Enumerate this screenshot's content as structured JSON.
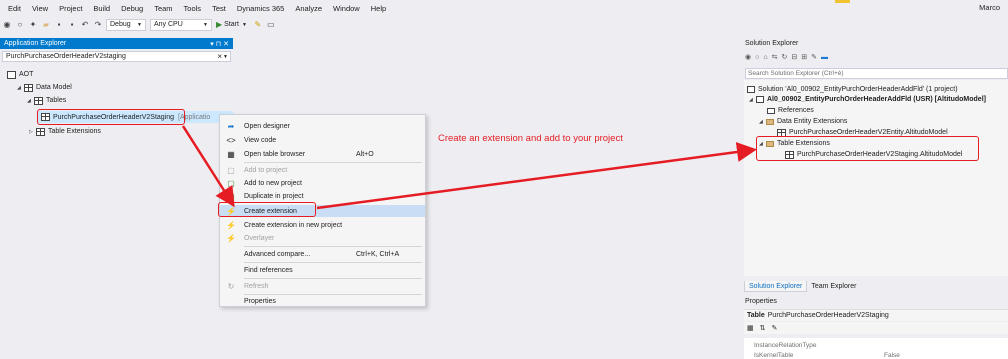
{
  "menu": {
    "items": [
      "Edit",
      "View",
      "Project",
      "Build",
      "Debug",
      "Team",
      "Tools",
      "Test",
      "Dynamics 365",
      "Analyze",
      "Window",
      "Help"
    ],
    "user": "Marco"
  },
  "toolbar": {
    "config": "Debug",
    "platform": "Any CPU",
    "start_label": "Start"
  },
  "app_explorer": {
    "title": "Application Explorer",
    "title_buttons": "▾ ⊓ ✕",
    "search_value": "PurchPurchaseOrderHeaderV2staging",
    "search_clear": "×",
    "tree": {
      "aot": "AOT",
      "data_model": "Data Model",
      "tables": "Tables",
      "table_item": "PurchPurchaseOrderHeaderV2Staging",
      "table_item_suffix": "[Applicatio",
      "table_extensions": "Table Extensions"
    }
  },
  "context_menu": {
    "items": [
      {
        "icon": "➦",
        "label": "Open designer",
        "shortcut": "",
        "disabled": false
      },
      {
        "icon": "<>",
        "label": "View code",
        "shortcut": "",
        "disabled": false
      },
      {
        "icon": "▦",
        "label": "Open table browser",
        "shortcut": "Alt+O",
        "disabled": false
      },
      {
        "icon": "▢",
        "label": "Add to project",
        "shortcut": "",
        "disabled": true
      },
      {
        "icon": "▢",
        "label": "Add to new project",
        "shortcut": "",
        "disabled": false
      },
      {
        "icon": "▢",
        "label": "Duplicate in project",
        "shortcut": "",
        "disabled": false
      },
      {
        "icon": "⚡",
        "label": "Create extension",
        "shortcut": "",
        "disabled": false
      },
      {
        "icon": "⚡",
        "label": "Create extension in new project",
        "shortcut": "",
        "disabled": false
      },
      {
        "icon": "⚡",
        "label": "Overlayer",
        "shortcut": "",
        "disabled": true
      },
      {
        "icon": "",
        "label": "Advanced compare...",
        "shortcut": "Ctrl+K, Ctrl+A",
        "disabled": false
      },
      {
        "icon": "",
        "label": "Find references",
        "shortcut": "",
        "disabled": false
      },
      {
        "icon": "↻",
        "label": "Refresh",
        "shortcut": "",
        "disabled": true
      },
      {
        "icon": "",
        "label": "Properties",
        "shortcut": "",
        "disabled": false
      }
    ]
  },
  "annotation": "Create an extension and add to your project",
  "solution_explorer": {
    "title": "Solution Explorer",
    "search_placeholder": "Search Solution Explorer (Ctrl+è)",
    "solution": "Solution 'Al0_00902_EntityPurchOrderHeaderAddFld' (1 project)",
    "project": "Al0_00902_EntityPurchOrderHeaderAddFld (USR) [AltitudoModel]",
    "references": "References",
    "data_entity_ext": "Data Entity Extensions",
    "entity_item": "PurchPurchaseOrderHeaderV2Entity.AltitudoModel",
    "table_ext": "Table Extensions",
    "table_ext_item": "PurchPurchaseOrderHeaderV2Staging.AltitudoModel",
    "tabs": [
      "Solution Explorer",
      "Team Explorer"
    ]
  },
  "properties": {
    "title": "Properties",
    "header_label": "Table",
    "header_value": "PurchPurchaseOrderHeaderV2Staging",
    "rows": [
      {
        "k": "InstanceRelationType",
        "v": ""
      },
      {
        "k": "IsKernelTable",
        "v": "False"
      }
    ]
  },
  "colors": {
    "accent": "#007acc",
    "highlight_red": "#e51c23",
    "menu_hover": "#c9def5"
  }
}
